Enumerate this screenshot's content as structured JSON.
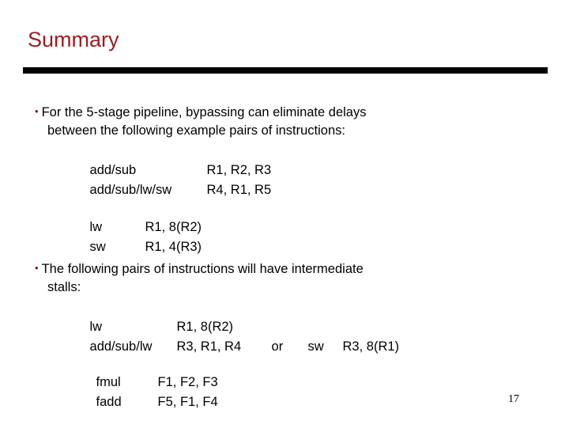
{
  "slide": {
    "title": "Summary",
    "title_color": "#9e1b1e",
    "rule_color": "#000000",
    "background_color": "#ffffff",
    "body_color": "#000000",
    "bullet_glyph": "•",
    "bullet_color": "#8c1216",
    "page_number": "17"
  },
  "bullets": [
    {
      "text": "For the 5-stage pipeline, bypassing can eliminate delays",
      "continuation": "between the following example pairs of instructions:",
      "rows": [
        {
          "op": "add/sub",
          "args": "R1, R2, R3"
        },
        {
          "op": "add/sub/lw/sw",
          "args": "R4, R1, R5"
        }
      ]
    },
    {
      "text": "The following pairs of instructions will have intermediate",
      "continuation": "stalls:",
      "rows": [
        {
          "op": "lw",
          "args": "R1, 8(R2)",
          "conj": "",
          "op2": "",
          "args2": ""
        },
        {
          "op": "add/sub/lw",
          "args": "R3, R1, R4",
          "conj": "or",
          "op2": "sw",
          "args2": "R3, 8(R1)"
        }
      ]
    }
  ],
  "code_blocks": [
    {
      "rows": [
        {
          "op": "lw",
          "args": "R1, 8(R2)"
        },
        {
          "op": "sw",
          "args": "R1, 4(R3)"
        }
      ]
    },
    {
      "rows": [
        {
          "op": "fmul",
          "args": "F1, F2, F3"
        },
        {
          "op": "fadd",
          "args": "F5, F1, F4"
        }
      ]
    }
  ]
}
